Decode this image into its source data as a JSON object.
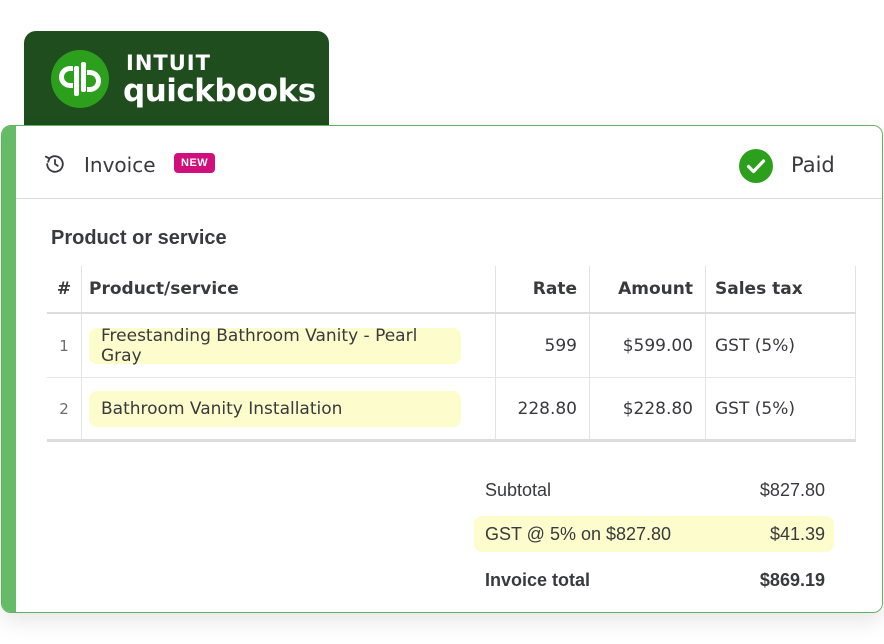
{
  "brand": {
    "line1": "INTUIT",
    "line2": "quickbooks",
    "mark_text": "qb",
    "color": "#1f4d1e"
  },
  "header": {
    "title": "Invoice",
    "badge": "NEW",
    "status": "Paid",
    "history_icon": "history-icon",
    "status_icon": "check-circle-icon"
  },
  "section": {
    "title": "Product or service"
  },
  "table": {
    "columns": [
      "#",
      "Product/service",
      "Rate",
      "Amount",
      "Sales tax"
    ],
    "rows": [
      {
        "num": "1",
        "product": "Freestanding Bathroom Vanity - Pearl Gray",
        "rate": "599",
        "amount": "$599.00",
        "tax": "GST (5%)"
      },
      {
        "num": "2",
        "product": "Bathroom Vanity Installation",
        "rate": "228.80",
        "amount": "$228.80",
        "tax": "GST (5%)"
      }
    ]
  },
  "totals": {
    "subtotal_label": "Subtotal",
    "subtotal_value": "$827.80",
    "gst_label": "GST @ 5% on $827.80",
    "gst_value": "$41.39",
    "total_label": "Invoice total",
    "total_value": "$869.19"
  },
  "colors": {
    "accent_green": "#66bb66",
    "badge_pink": "#d10f7c",
    "paid_green": "#2ca01c",
    "highlight": "#fdfccc"
  }
}
